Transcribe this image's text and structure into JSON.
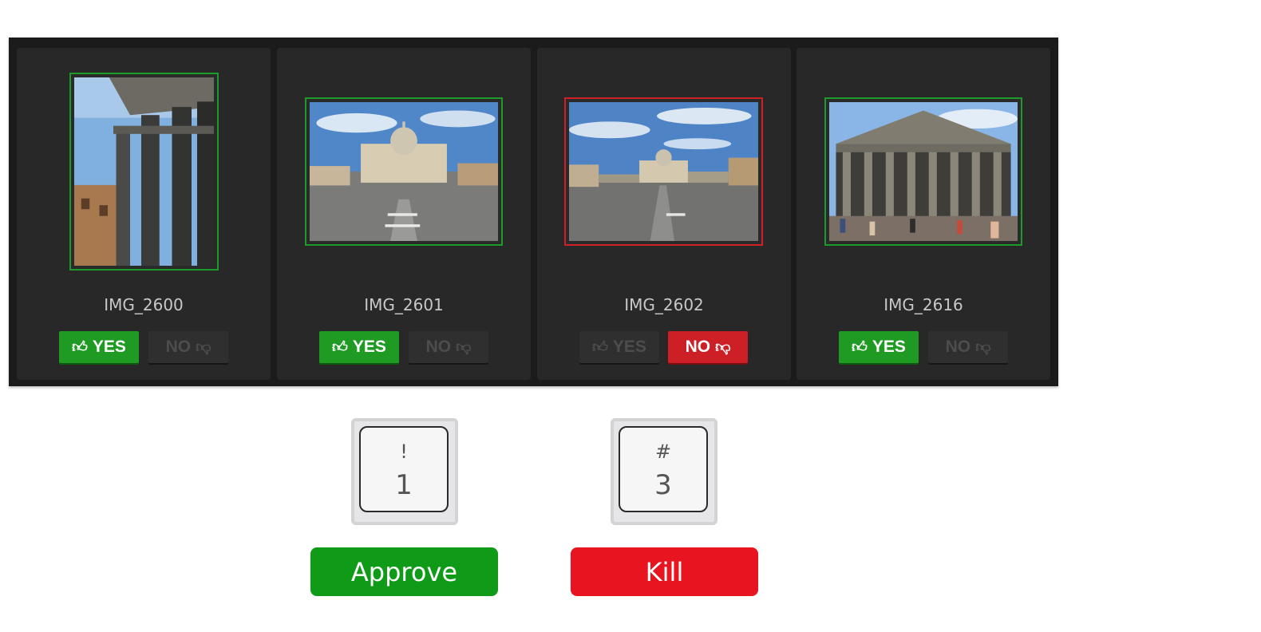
{
  "cards": [
    {
      "filename": "IMG_2600",
      "yes_label": "YES",
      "no_label": "NO",
      "status": "approved"
    },
    {
      "filename": "IMG_2601",
      "yes_label": "YES",
      "no_label": "NO",
      "status": "approved"
    },
    {
      "filename": "IMG_2602",
      "yes_label": "YES",
      "no_label": "NO",
      "status": "rejected"
    },
    {
      "filename": "IMG_2616",
      "yes_label": "YES",
      "no_label": "NO",
      "status": "approved"
    }
  ],
  "keys": [
    {
      "shift": "!",
      "main": "1"
    },
    {
      "shift": "#",
      "main": "3"
    }
  ],
  "actions": {
    "approve_label": "Approve",
    "kill_label": "Kill"
  },
  "colors": {
    "approve": "#0f9a17",
    "kill": "#e8141f",
    "approved_border": "#1e9a2a",
    "rejected_border": "#cf2027",
    "panel_bg": "#1b1b1b",
    "card_bg": "#282828"
  },
  "icons": {
    "yes": "thumbs-up-icon",
    "no": "thumbs-down-icon"
  }
}
